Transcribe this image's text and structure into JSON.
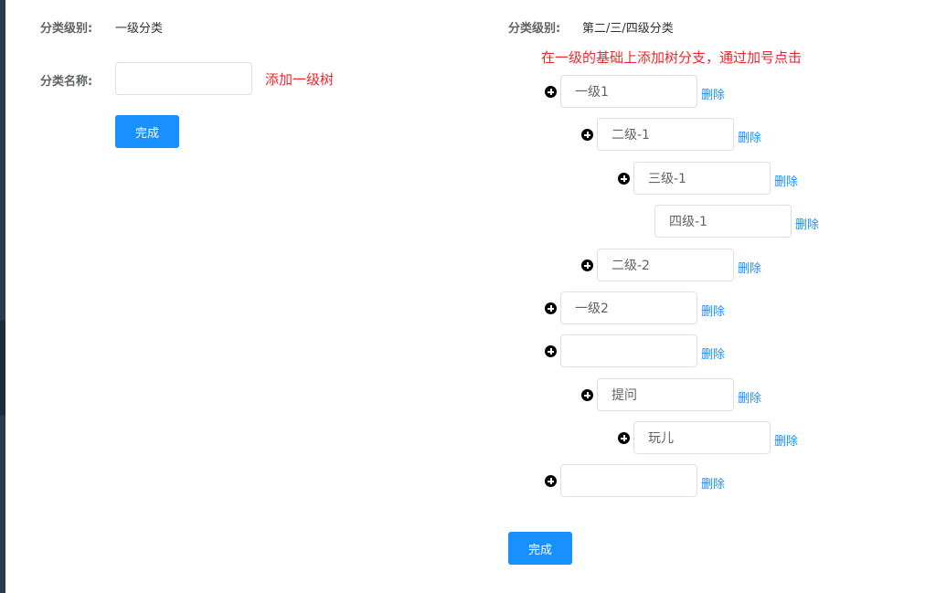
{
  "left": {
    "level_label": "分类级别:",
    "level_value": "一级分类",
    "name_label": "分类名称:",
    "name_input_value": "",
    "hint": "添加一级树",
    "submit_label": "完成"
  },
  "right": {
    "level_label": "分类级别:",
    "level_value": "第二/三/四级分类",
    "hint": "在一级的基础上添加树分支，通过加号点击",
    "delete_label": "删除",
    "submit_label": "完成",
    "nodes": [
      {
        "value": "一级1",
        "level": 1,
        "has_add": true,
        "has_delete": true
      },
      {
        "value": "二级-1",
        "level": 2,
        "has_add": true,
        "has_delete": true
      },
      {
        "value": "三级-1",
        "level": 3,
        "has_add": true,
        "has_delete": true
      },
      {
        "value": "四级-1",
        "level": 4,
        "has_add": false,
        "has_delete": true
      },
      {
        "value": "二级-2",
        "level": 2,
        "has_add": true,
        "has_delete": true
      },
      {
        "value": "一级2",
        "level": 1,
        "has_add": true,
        "has_delete": true
      },
      {
        "value": "",
        "level": 1,
        "has_add": true,
        "has_delete": true
      },
      {
        "value": "提问",
        "level": 2,
        "has_add": true,
        "has_delete": true
      },
      {
        "value": "玩儿",
        "level": 3,
        "has_add": true,
        "has_delete": true
      },
      {
        "value": "",
        "level": 1,
        "has_add": true,
        "has_delete": true
      }
    ]
  }
}
